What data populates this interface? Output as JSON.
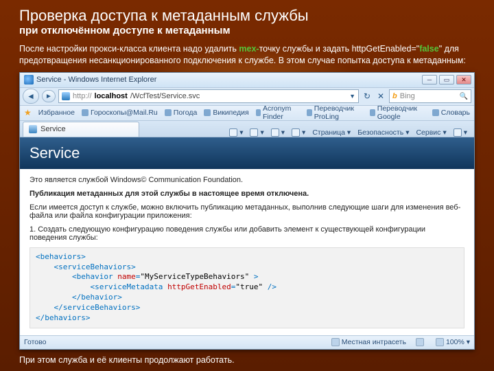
{
  "slide": {
    "title": "Проверка доступа к метаданным службы",
    "subtitle": "при отключённом доступе к метаданным",
    "intro_1": "После настройки прокси-класса клиента надо удалить ",
    "intro_mex": "mex-",
    "intro_2": "точку службы и задать httpGetEnabled=\"",
    "intro_false": "false",
    "intro_3": "\" для предотвращения несанкционированного подключения к службе. В этом случае попытка доступа к метаданным:",
    "outro": "При этом служба и её клиенты продолжают работать."
  },
  "ie": {
    "title": "Service - Windows Internet Explorer",
    "url_proto": "http://",
    "url_host": "localhost",
    "url_path": "/WcfTest/Service.svc",
    "search_engine": "b",
    "search_placeholder": "Bing",
    "favbar_label": "Избранное",
    "favlinks": [
      "Гороскопы@Mail.Ru",
      "Погода",
      "Википедия",
      "Acronym Finder",
      "Переводчик ProLing",
      "Переводчик Google",
      "Словарь"
    ],
    "tab_label": "Service",
    "tools": {
      "home": "",
      "feeds": "",
      "mail": "",
      "print": "",
      "page": "Страница",
      "safety": "Безопасность",
      "tools": "Сервис"
    },
    "status_ready": "Готово",
    "status_zone": "Местная интрасеть",
    "status_zoom": "100%"
  },
  "page": {
    "banner": "Service",
    "p1": "Это является службой Windows© Communication Foundation.",
    "p2": "Публикация метаданных для этой службы в настоящее время отключена.",
    "p3": "Если имеется доступ к службе, можно включить публикацию метаданных, выполнив следующие шаги для изменения веб-файла или файла конфигурации приложения:",
    "p4": "1. Создать следующую конфигурацию поведения службы или добавить элемент к существующей конфигурации поведения службы:",
    "code": {
      "l1": "<behaviors>",
      "l2": "    <serviceBehaviors>",
      "l3a": "        <behavior ",
      "l3name": "name",
      "l3eq": "=",
      "l3val": "\"MyServiceTypeBehaviors\"",
      "l3b": " >",
      "l4a": "            <serviceMetadata ",
      "l4name": "httpGetEnabled",
      "l4eq": "=",
      "l4val": "\"true\"",
      "l4b": " />",
      "l5": "        </behavior>",
      "l6": "    </serviceBehaviors>",
      "l7": "</behaviors>"
    }
  }
}
